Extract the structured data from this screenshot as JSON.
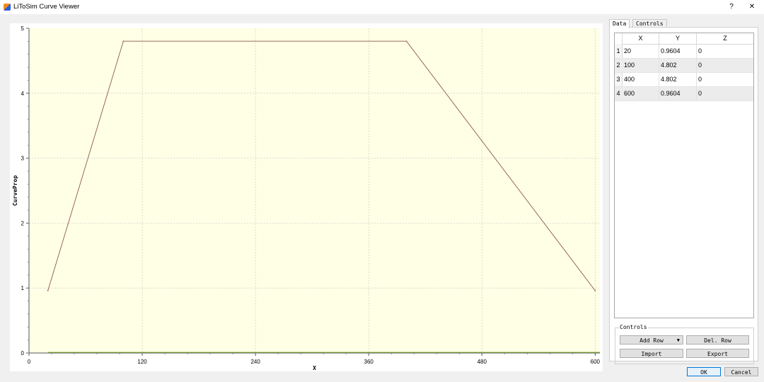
{
  "window": {
    "title": "LiToSim Curve Viewer",
    "help_glyph": "?",
    "close_glyph": "✕"
  },
  "colors": {
    "plot_bg": "#ffffe6",
    "curve": "#8b5a4a",
    "grid": "#d2d2c8",
    "baseline": "#8cbf3f"
  },
  "chart_data": {
    "type": "line",
    "xlabel": "X",
    "ylabel": "CurveProp",
    "xlim": [
      0,
      605
    ],
    "ylim": [
      0,
      5
    ],
    "x_ticks": [
      0,
      120,
      240,
      360,
      480,
      600
    ],
    "y_ticks": [
      0,
      1,
      2,
      3,
      4,
      5
    ],
    "grid": true,
    "series": [
      {
        "x": [
          20,
          100,
          400,
          600
        ],
        "y": [
          0.9604,
          4.802,
          4.802,
          0.9604
        ]
      }
    ]
  },
  "tabs": {
    "data": "Data",
    "controls": "Controls"
  },
  "table": {
    "columns": [
      "X",
      "Y",
      "Z"
    ],
    "rows": [
      {
        "index": "1",
        "x": "20",
        "y": "0.9604",
        "z": "0"
      },
      {
        "index": "2",
        "x": "100",
        "y": "4.802",
        "z": "0"
      },
      {
        "index": "3",
        "x": "400",
        "y": "4.802",
        "z": "0"
      },
      {
        "index": "4",
        "x": "600",
        "y": "0.9604",
        "z": "0"
      }
    ]
  },
  "controls": {
    "title": "Controls",
    "add_row": "Add Row",
    "add_row_arrow": "▼",
    "del_row": "Del. Row",
    "import": "Import",
    "export": "Export"
  },
  "dialog": {
    "ok": "OK",
    "cancel": "Cancel"
  }
}
